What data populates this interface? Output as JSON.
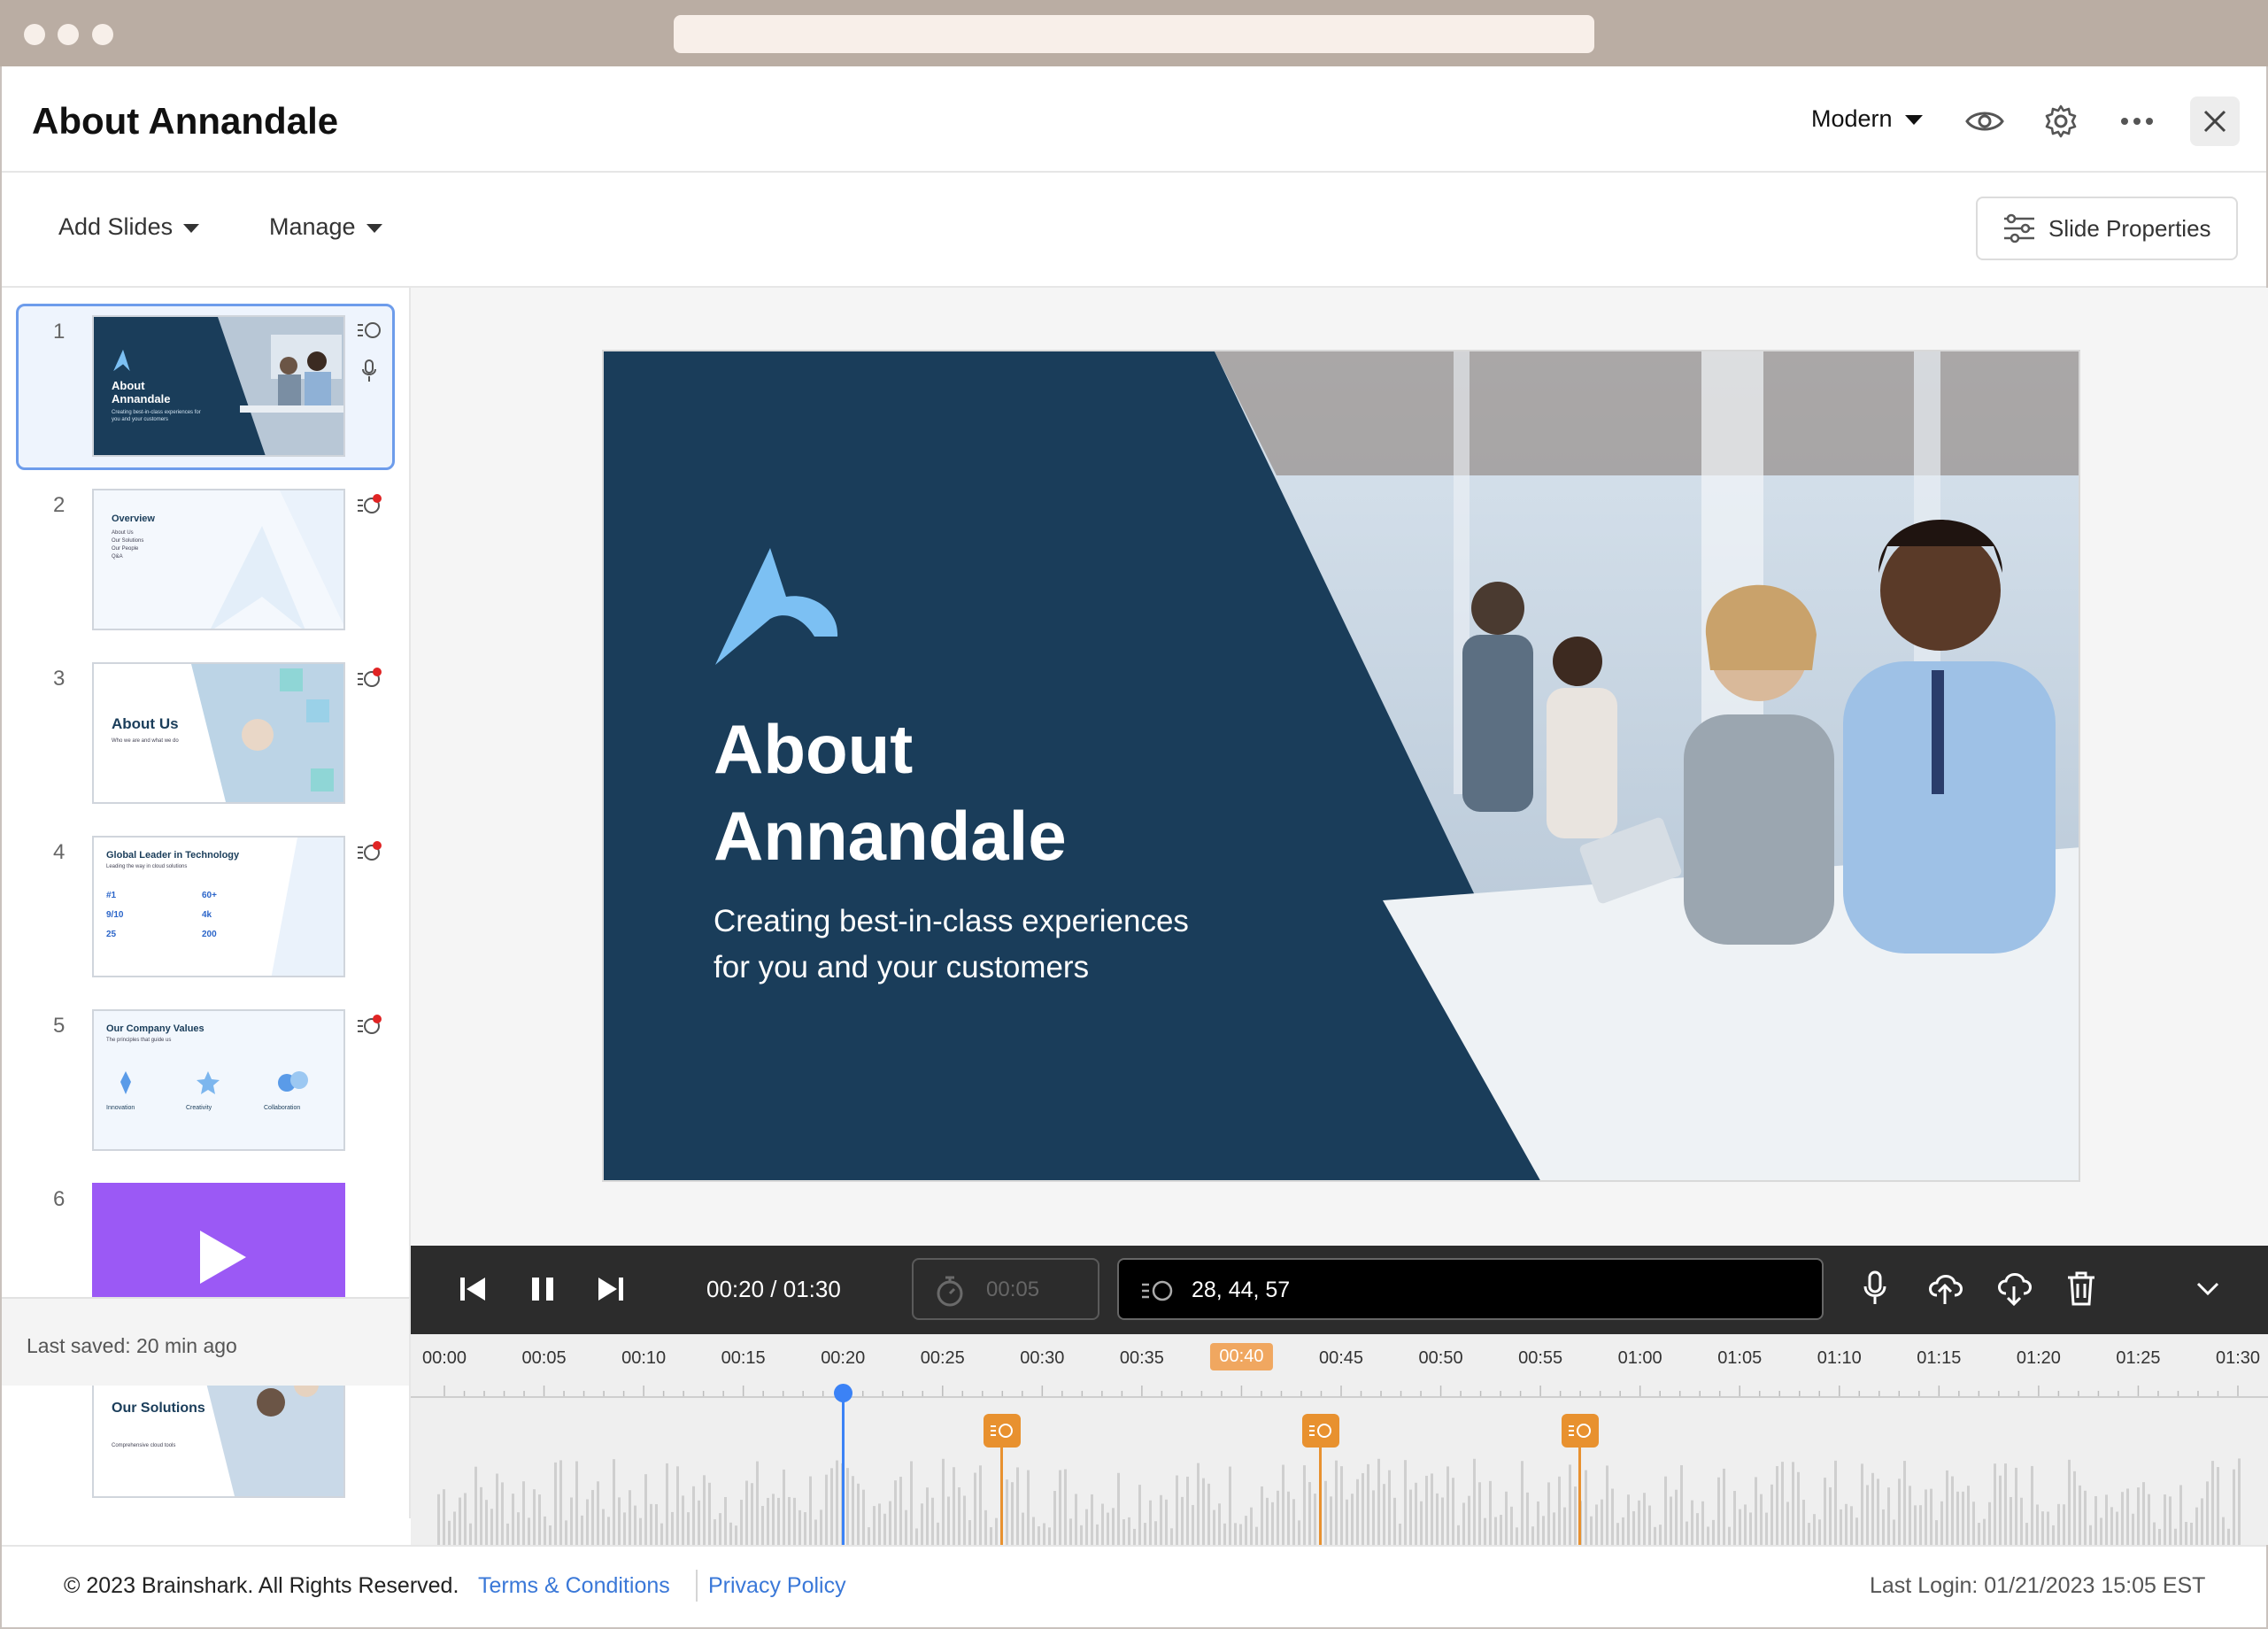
{
  "app": {
    "title": "About Annandale",
    "theme_label": "Modern"
  },
  "toolbar": {
    "add_slides": "Add Slides",
    "manage": "Manage",
    "slide_properties": "Slide Properties"
  },
  "sidebar": {
    "slides": [
      {
        "num": "1",
        "title": "About Annandale",
        "subtitle": "Creating best-in-class experiences for you and your customers"
      },
      {
        "num": "2",
        "title": "Overview",
        "items": [
          "About Us",
          "Our Solutions",
          "Our People",
          "Q&A"
        ]
      },
      {
        "num": "3",
        "title": "About Us",
        "subtitle": "Who we are and what we do"
      },
      {
        "num": "4",
        "title": "Global Leader in Technology",
        "subtitle": "Leading the way in cloud solutions",
        "stats": [
          "#1",
          "60+",
          "9/10",
          "4k",
          "25",
          "200"
        ]
      },
      {
        "num": "5",
        "title": "Our Company Values",
        "subtitle": "The principles that guide us",
        "values": [
          "Innovation",
          "Creativity",
          "Collaboration"
        ]
      },
      {
        "num": "6"
      },
      {
        "num": "7",
        "title": "Our Solutions",
        "subtitle": "Comprehensive cloud tools"
      }
    ],
    "last_saved": "Last saved: 20 min ago"
  },
  "slide_main": {
    "title_line1": "About",
    "title_line2": "Annandale",
    "subtitle_line1": "Creating best-in-class experiences",
    "subtitle_line2": "for you and your customers"
  },
  "player": {
    "time": "00:20 / 01:30",
    "duration_placeholder": "00:05",
    "cues": "28, 44, 57"
  },
  "timeline": {
    "ticks": [
      "00:00",
      "00:05",
      "00:10",
      "00:15",
      "00:20",
      "00:25",
      "00:30",
      "00:35",
      "00:40",
      "00:45",
      "00:50",
      "00:55",
      "01:00",
      "01:05",
      "01:10",
      "01:15",
      "01:20",
      "01:25",
      "01:30"
    ],
    "active_tick": "00:40",
    "playhead_seconds": 20,
    "cue_seconds": [
      28,
      44,
      57
    ],
    "total_seconds": 90
  },
  "footer": {
    "copyright": "© 2023 Brainshark. All Rights Reserved.",
    "terms": "Terms & Conditions",
    "privacy": "Privacy Policy",
    "last_login": "Last Login: 01/21/2023 15:05 EST"
  },
  "colors": {
    "accent_blue": "#3b82f6",
    "cue_orange": "#e8912f",
    "slide_navy": "#1a3d5a",
    "video_purple": "#9b59f5"
  }
}
